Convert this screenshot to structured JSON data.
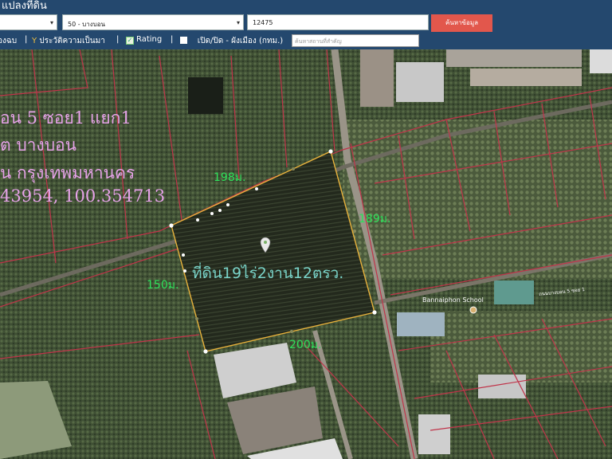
{
  "header": {
    "title": "แปลงที่ดิน",
    "province_select": {
      "value": ""
    },
    "district_select": {
      "value": "50 - บางบอน"
    },
    "parcel_input": {
      "value": "12475"
    },
    "search_button": "ค้นหาข้อมูล"
  },
  "toolbar": {
    "street_view": "องฉบ",
    "separator": "|",
    "history_label": "ประวัติความเป็นมา",
    "rating_label": "Rating",
    "layer_label": "เปิด/ปิด - ผังเมือง (กทม.)",
    "place_search_placeholder": "ค้นหาสถานที่สำคัญ"
  },
  "map": {
    "address_line1": "อน 5 ซอย1 แยก1",
    "address_line2": "ต บางบอน",
    "address_line3": "น กรุงเทพมหานคร",
    "coords": "43954, 100.354713",
    "dimensions": {
      "north": "198ม.",
      "east": "189ม.",
      "west": "150ม.",
      "south": "200ม."
    },
    "area_label": "ที่ดิน19ไร่2งาน12ตรว.",
    "school_label": "Bannaiphon School",
    "road_label": "ถนนบางบอน 5 ซอย 1",
    "colors": {
      "parcel_outline": "#e8b23c",
      "cadastral_lines": "#c0344a",
      "area_label": "#79d3c8",
      "dimension_labels": "#2ee05a",
      "address_text": "#e6a2e8"
    }
  }
}
